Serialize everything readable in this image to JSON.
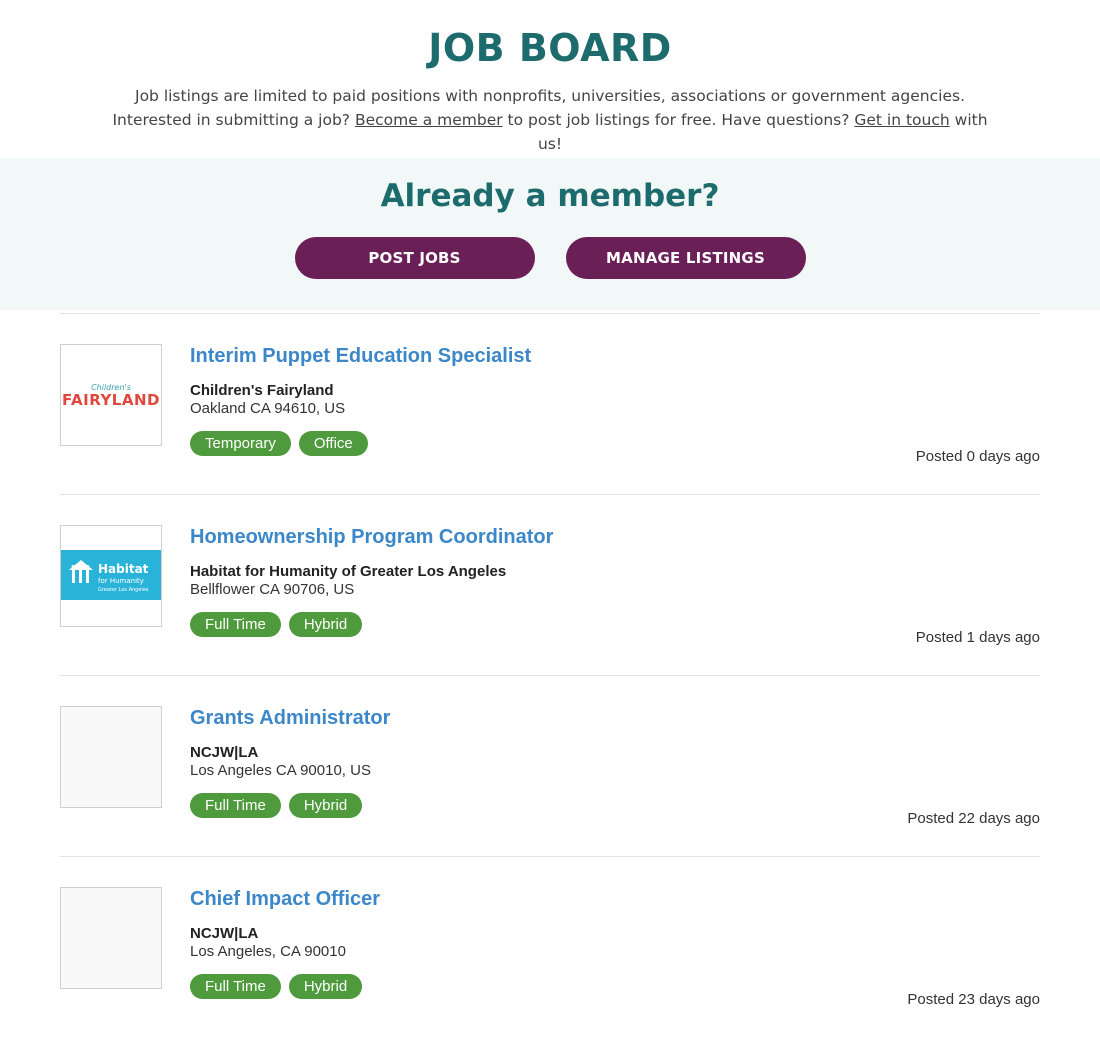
{
  "header": {
    "title": "JOB BOARD",
    "intro": {
      "text1": "Job listings are limited to paid positions with nonprofits, universities, associations or government agencies. Interested in submitting a job? ",
      "link1": "Become a member",
      "text2": " to post job listings for free. Have questions? ",
      "link2": "Get in touch",
      "text3": " with us!"
    }
  },
  "member": {
    "title": "Already a member?",
    "post_jobs": "POST JOBS",
    "manage_listings": "MANAGE LISTINGS"
  },
  "jobs": [
    {
      "title": "Interim Puppet Education Specialist",
      "org": "Children's Fairyland",
      "location": "Oakland CA 94610, US",
      "tags": [
        "Temporary",
        "Office"
      ],
      "posted": "Posted 0 days ago",
      "logo": {
        "type": "fairyland",
        "small_text": "Children's",
        "big_text": "FAIRYLAND"
      }
    },
    {
      "title": "Homeownership Program Coordinator",
      "org": "Habitat for Humanity of Greater Los Angeles",
      "location": "Bellflower CA 90706, US",
      "tags": [
        "Full Time",
        "Hybrid"
      ],
      "posted": "Posted 1 days ago",
      "logo": {
        "type": "habitat",
        "line1": "Habitat",
        "line2": "for Humanity",
        "line3": "Greater Los Angeles",
        "color": "#2ab3d9"
      }
    },
    {
      "title": "Grants Administrator",
      "org": "NCJW|LA",
      "location": "Los Angeles CA 90010, US",
      "tags": [
        "Full Time",
        "Hybrid"
      ],
      "posted": "Posted 22 days ago",
      "logo": {
        "type": "blank"
      }
    },
    {
      "title": "Chief Impact Officer",
      "org": "NCJW|LA",
      "location": "Los Angeles, CA 90010",
      "tags": [
        "Full Time",
        "Hybrid"
      ],
      "posted": "Posted 23 days ago",
      "logo": {
        "type": "blank"
      }
    }
  ],
  "colors": {
    "heading": "#1e6b6e",
    "button": "#6b1f57",
    "link": "#3b87c9",
    "tag": "#4f9a3d",
    "band": "#f1f8f7"
  }
}
